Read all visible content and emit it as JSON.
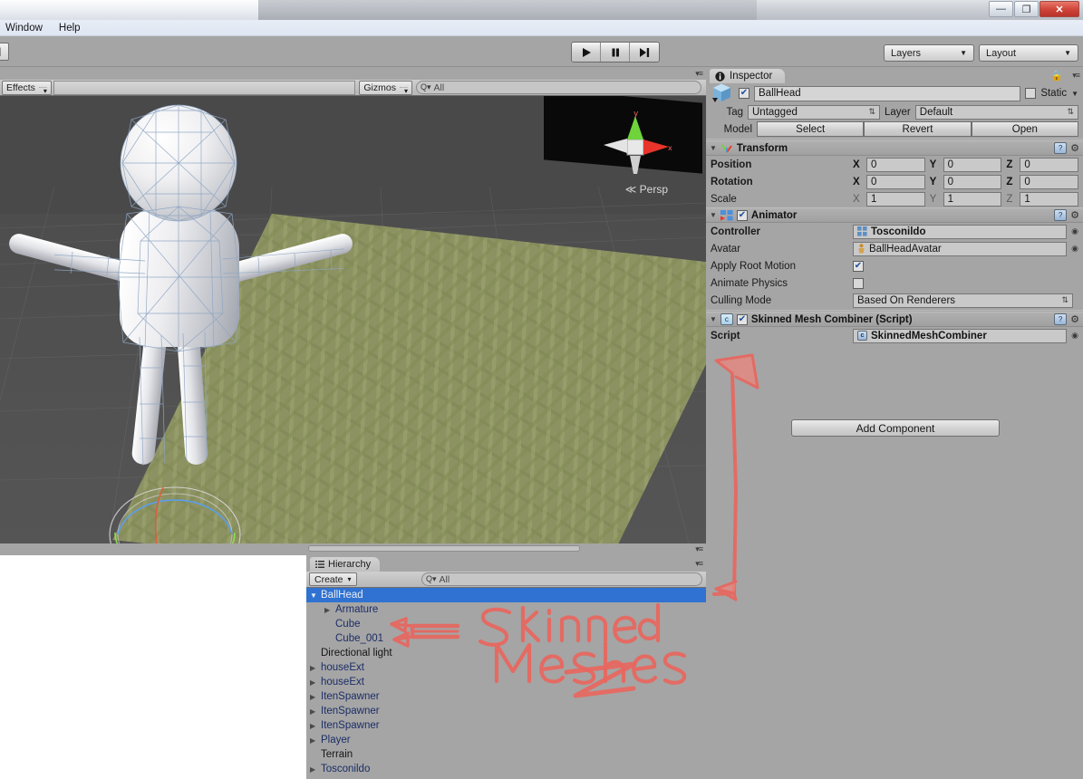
{
  "window": {
    "minimize_label": "—",
    "maximize_label": "❐",
    "close_label": "✕",
    "menu": [
      "Window",
      "Help"
    ]
  },
  "toolbar": {
    "hand_tool_label": "|",
    "play_label": "▶",
    "pause_label": "❚❚",
    "step_label": "▶|",
    "layers_label": "Layers",
    "layout_label": "Layout",
    "caret": "▼"
  },
  "scene": {
    "effects_label": "Effects",
    "effects_caret": "▾",
    "gizmos_label": "Gizmos",
    "gizmos_caret": "▾",
    "search_icon": "search-icon",
    "search_placeholder": "All",
    "search_prefix": "Q▾",
    "persp_label": "Persp",
    "persp_arrow": "≪",
    "axis_y_label": "y",
    "axis_x_label": "x",
    "panel_menu": "▾≡"
  },
  "hierarchy": {
    "tab_label": "Hierarchy",
    "tab_icon": "hierarchy-icon",
    "create_label": "Create",
    "create_caret": "▾",
    "search_prefix": "Q▾",
    "search_placeholder": "All",
    "panel_menu": "▾≡",
    "items": [
      {
        "label": "BallHead",
        "indent": 0,
        "arrow": "▼",
        "selected": true,
        "prefab": true
      },
      {
        "label": "Armature",
        "indent": 1,
        "arrow": "▶",
        "selected": false,
        "prefab": true
      },
      {
        "label": "Cube",
        "indent": 1,
        "arrow": "",
        "selected": false,
        "prefab": true
      },
      {
        "label": "Cube_001",
        "indent": 1,
        "arrow": "",
        "selected": false,
        "prefab": true
      },
      {
        "label": "Directional light",
        "indent": 0,
        "arrow": "",
        "selected": false,
        "prefab": false
      },
      {
        "label": "houseExt",
        "indent": 0,
        "arrow": "▶",
        "selected": false,
        "prefab": true
      },
      {
        "label": "houseExt",
        "indent": 0,
        "arrow": "▶",
        "selected": false,
        "prefab": true
      },
      {
        "label": "ItenSpawner",
        "indent": 0,
        "arrow": "▶",
        "selected": false,
        "prefab": true
      },
      {
        "label": "ItenSpawner",
        "indent": 0,
        "arrow": "▶",
        "selected": false,
        "prefab": true
      },
      {
        "label": "ItenSpawner",
        "indent": 0,
        "arrow": "▶",
        "selected": false,
        "prefab": true
      },
      {
        "label": "Player",
        "indent": 0,
        "arrow": "▶",
        "selected": false,
        "prefab": true
      },
      {
        "label": "Terrain",
        "indent": 0,
        "arrow": "",
        "selected": false,
        "prefab": false
      },
      {
        "label": "Tosconildo",
        "indent": 0,
        "arrow": "▶",
        "selected": false,
        "prefab": true
      }
    ]
  },
  "inspector": {
    "tab_label": "Inspector",
    "tab_icon": "info-icon",
    "lock_icon": "lock-icon",
    "panel_menu": "▾≡",
    "object_icon": "prefab-cube-icon",
    "enabled_checkbox": true,
    "object_name": "BallHead",
    "static_label": "Static",
    "static_checked": false,
    "static_caret": "▼",
    "tag_label": "Tag",
    "tag_value": "Untagged",
    "layer_label": "Layer",
    "layer_value": "Default",
    "model_label": "Model",
    "model_buttons": [
      "Select",
      "Revert",
      "Open"
    ],
    "add_component_label": "Add Component",
    "transform": {
      "title": "Transform",
      "icon": "transform-icon",
      "foldout": "▼",
      "help_icon": "help-icon",
      "gear_icon": "gear-icon",
      "rows": [
        {
          "label": "Position",
          "bold": true,
          "x": "0",
          "y": "0",
          "z": "0"
        },
        {
          "label": "Rotation",
          "bold": true,
          "x": "0",
          "y": "0",
          "z": "0"
        },
        {
          "label": "Scale",
          "bold": false,
          "x": "1",
          "y": "1",
          "z": "1"
        }
      ]
    },
    "animator": {
      "title": "Animator",
      "icon": "animator-icon",
      "foldout": "▼",
      "enabled": true,
      "help_icon": "help-icon",
      "gear_icon": "gear-icon",
      "controller_label": "Controller",
      "controller_value": "Tosconildo",
      "controller_icon": "controller-icon",
      "avatar_label": "Avatar",
      "avatar_value": "BallHeadAvatar",
      "avatar_icon": "avatar-icon",
      "apply_root_motion_label": "Apply Root Motion",
      "apply_root_motion": true,
      "animate_physics_label": "Animate Physics",
      "animate_physics": false,
      "culling_mode_label": "Culling Mode",
      "culling_mode_value": "Based On Renderers"
    },
    "skinned_mesh_combiner": {
      "title": "Skinned Mesh Combiner (Script)",
      "icon": "csharp-script-icon",
      "foldout": "▼",
      "enabled": true,
      "help_icon": "help-icon",
      "gear_icon": "gear-icon",
      "script_label": "Script",
      "script_value": "SkinnedMeshCombiner",
      "script_icon": "csharp-script-icon"
    }
  },
  "annotations": {
    "text_line1": "Skinned",
    "text_line2": "Meshes",
    "color": "#e8675f",
    "marks": [
      "double-arrow-to-cube-rows",
      "squiggle-underline",
      "tall-double-arrow-inspector"
    ]
  },
  "colors": {
    "panel_bg": "#a5a5a5",
    "selection_blue": "#2f72d1",
    "prefab_text": "#1b2d66",
    "terrain_green": "#8d9263",
    "scene_bg": "#494949",
    "annotation_red": "#e8675f"
  }
}
